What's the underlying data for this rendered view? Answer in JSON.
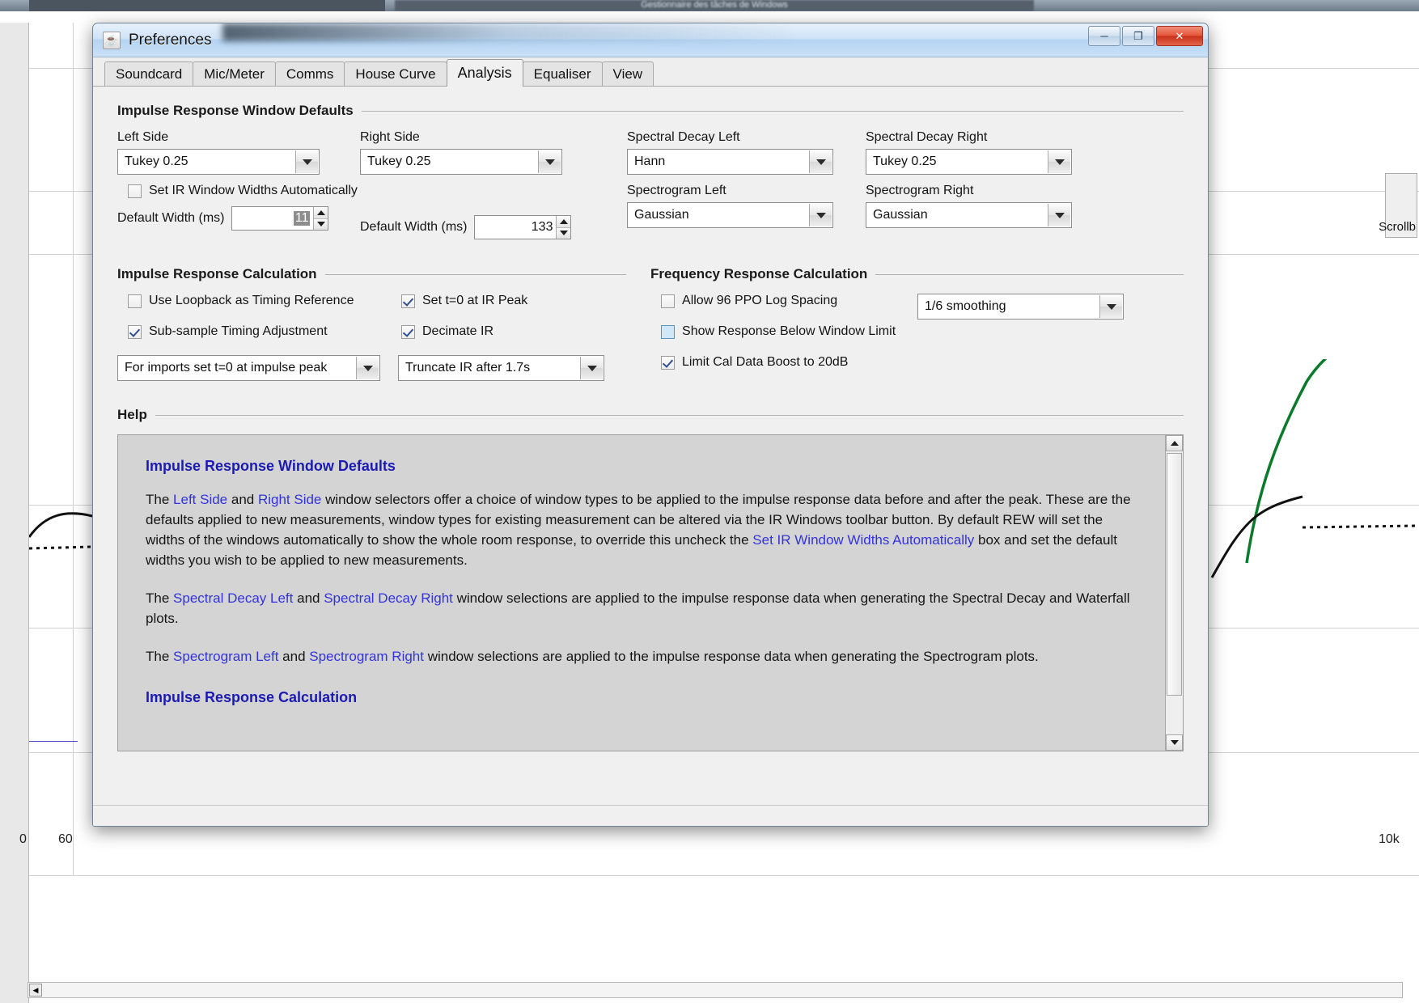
{
  "window": {
    "title": "Preferences",
    "icon": "java-coffee-cup-icon",
    "minimize_label": "─",
    "maximize_label": "❐",
    "close_label": "✕"
  },
  "tabs": [
    {
      "label": "Soundcard",
      "active": false
    },
    {
      "label": "Mic/Meter",
      "active": false
    },
    {
      "label": "Comms",
      "active": false
    },
    {
      "label": "House Curve",
      "active": false
    },
    {
      "label": "Analysis",
      "active": true
    },
    {
      "label": "Equaliser",
      "active": false
    },
    {
      "label": "View",
      "active": false
    }
  ],
  "ir_window_defaults": {
    "title": "Impulse Response Window Defaults",
    "left_side": {
      "label": "Left Side",
      "value": "Tukey 0.25"
    },
    "right_side": {
      "label": "Right Side",
      "value": "Tukey 0.25"
    },
    "spectral_decay_left": {
      "label": "Spectral Decay Left",
      "value": "Hann"
    },
    "spectral_decay_right": {
      "label": "Spectral Decay Right",
      "value": "Tukey 0.25"
    },
    "spectrogram_left": {
      "label": "Spectrogram Left",
      "value": "Gaussian"
    },
    "spectrogram_right": {
      "label": "Spectrogram Right",
      "value": "Gaussian"
    },
    "auto_widths": {
      "label": "Set IR Window Widths Automatically",
      "checked": false
    },
    "default_width_left": {
      "label": "Default Width (ms)",
      "value": "11",
      "selected": true
    },
    "default_width_right": {
      "label": "Default Width (ms)",
      "value": "133",
      "selected": false
    }
  },
  "ir_calculation": {
    "title": "Impulse Response Calculation",
    "use_loopback": {
      "label": "Use Loopback as Timing Reference",
      "checked": false
    },
    "set_t0_at_peak": {
      "label": "Set t=0 at IR Peak",
      "checked": true
    },
    "sub_sample": {
      "label": "Sub-sample Timing Adjustment",
      "checked": true
    },
    "decimate_ir": {
      "label": "Decimate IR",
      "checked": true
    },
    "imports_combo": {
      "value": "For imports set t=0 at impulse peak"
    },
    "truncate_combo": {
      "value": "Truncate IR after 1.7s"
    }
  },
  "fr_calculation": {
    "title": "Frequency Response Calculation",
    "allow_96ppo": {
      "label": "Allow 96 PPO Log Spacing",
      "checked": false
    },
    "show_below_window": {
      "label": "Show Response Below Window Limit",
      "checked": false,
      "focused": true
    },
    "limit_cal_boost": {
      "label": "Limit Cal Data Boost to 20dB",
      "checked": true
    },
    "smoothing_combo": {
      "value": "1/6 smoothing"
    }
  },
  "help": {
    "title": "Help",
    "heading1": "Impulse Response Window Defaults",
    "p1_a": "The ",
    "p1_link1": "Left Side",
    "p1_b": " and ",
    "p1_link2": "Right Side",
    "p1_c": " window selectors offer a choice of window types to be applied to the impulse response data before and after the peak. These are the defaults applied to new measurements, window types for existing measurement can be altered via the IR Windows toolbar button. By default REW will set the widths of the windows automatically to show the whole room response, to override this uncheck the ",
    "p1_link3": "Set IR Window Widths Automatically",
    "p1_d": " box and set the default widths you wish to be applied to new measurements.",
    "p2_a": "The ",
    "p2_link1": "Spectral Decay Left",
    "p2_b": " and ",
    "p2_link2": "Spectral Decay Right",
    "p2_c": " window selections are applied to the impulse response data when generating the Spectral Decay and Waterfall plots.",
    "p3_a": "The ",
    "p3_link1": "Spectrogram Left",
    "p3_b": " and ",
    "p3_link2": "Spectrogram Right",
    "p3_c": " window selections are applied to the impulse response data when generating the Spectrogram plots.",
    "heading2": "Impulse Response Calculation"
  },
  "background": {
    "axis_label_60": "60",
    "axis_label_10k": "10k",
    "axis_label_0": "0",
    "scrollbar_label": "Scrollb",
    "taskmanager_title": "Gestionnaire des tâches de Windows"
  },
  "colors": {
    "dialog_bg": "#f0f0f0",
    "help_bg": "#d4d4d4",
    "link_blue": "#3333dd",
    "heading_blue": "#1b1bb3",
    "title_gradient_top": "#e8f1fb",
    "close_red": "#c8301a"
  }
}
